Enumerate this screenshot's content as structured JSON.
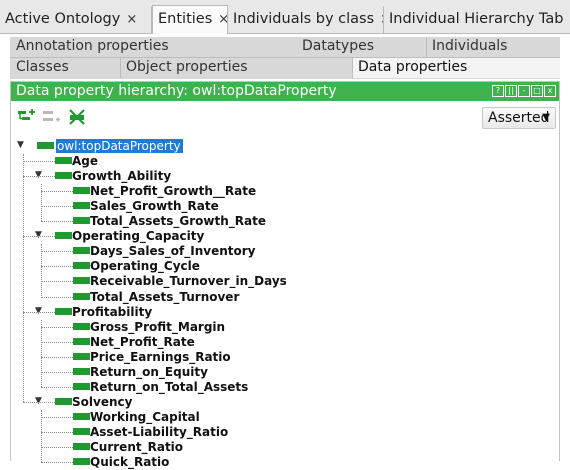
{
  "tabs": [
    {
      "label": "Active Ontology",
      "active": false,
      "closable": true
    },
    {
      "label": "Entities",
      "active": true,
      "closable": true
    },
    {
      "label": "Individuals by class",
      "active": false,
      "closable": true
    },
    {
      "label": "Individual Hierarchy Tab",
      "active": false,
      "closable": true
    }
  ],
  "close_glyph": "×",
  "subtabs_row1": [
    "Annotation properties",
    "Datatypes",
    "Individuals"
  ],
  "subtabs_row2": [
    "Classes",
    "Object properties",
    "Data properties"
  ],
  "active_subtab": "Data properties",
  "panel": {
    "title": "Data property hierarchy: owl:topDataProperty",
    "window_buttons": [
      "?",
      "||",
      "-",
      "□",
      "x"
    ],
    "view_mode": "Asserted",
    "accent_color": "#3fb24d",
    "property_color": "#219930",
    "selection_color": "#1e7bd6"
  },
  "toolbar_icons": [
    "add-sub-property-icon",
    "add-sibling-property-icon",
    "delete-property-icon"
  ],
  "tree": [
    {
      "label": "owl:topDataProperty",
      "depth": 0,
      "expanded": true,
      "selected": true
    },
    {
      "label": "Age",
      "depth": 1
    },
    {
      "label": "Growth_Ability",
      "depth": 1,
      "expanded": true
    },
    {
      "label": "Net_Profit_Growth__Rate",
      "depth": 2
    },
    {
      "label": "Sales_Growth_Rate",
      "depth": 2
    },
    {
      "label": "Total_Assets_Growth_Rate",
      "depth": 2
    },
    {
      "label": "Operating_Capacity",
      "depth": 1,
      "expanded": true
    },
    {
      "label": "Days_Sales_of_Inventory",
      "depth": 2
    },
    {
      "label": "Operating_Cycle",
      "depth": 2
    },
    {
      "label": "Receivable_Turnover_in_Days",
      "depth": 2
    },
    {
      "label": "Total_Assets_Turnover",
      "depth": 2
    },
    {
      "label": "Profitability",
      "depth": 1,
      "expanded": true
    },
    {
      "label": "Gross_Profit_Margin",
      "depth": 2
    },
    {
      "label": "Net_Profit_Rate",
      "depth": 2
    },
    {
      "label": "Price_Earnings_Ratio",
      "depth": 2
    },
    {
      "label": "Return_on_Equity",
      "depth": 2
    },
    {
      "label": "Return_on_Total_Assets",
      "depth": 2
    },
    {
      "label": "Solvency",
      "depth": 1,
      "expanded": true
    },
    {
      "label": "Working_Capital",
      "depth": 2
    },
    {
      "label": "Asset-Liability_Ratio",
      "depth": 2
    },
    {
      "label": "Current_Ratio",
      "depth": 2
    },
    {
      "label": "Quick_Ratio",
      "depth": 2
    }
  ]
}
